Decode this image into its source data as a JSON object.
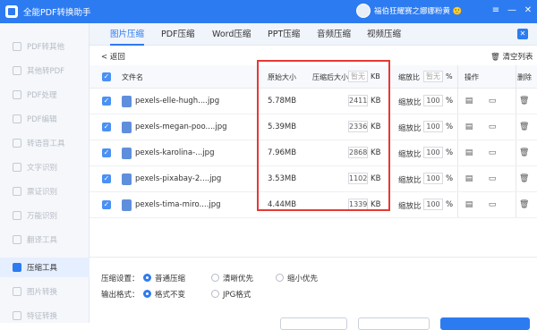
{
  "app": {
    "title": "全能PDF转换助手",
    "user_name": "福伯狂耀赛之娜娜粉黄 🙂"
  },
  "window": {
    "menu": "≡",
    "minimize": "—",
    "close": "✕"
  },
  "sidebar": {
    "items": [
      {
        "label": "PDF转其他"
      },
      {
        "label": "其他转PDF"
      },
      {
        "label": "PDF处理"
      },
      {
        "label": "PDF编辑"
      },
      {
        "label": "转语音工具"
      },
      {
        "label": "文字识别"
      },
      {
        "label": "票证识别"
      },
      {
        "label": "万能识别"
      },
      {
        "label": "翻译工具"
      },
      {
        "label": "压缩工具"
      },
      {
        "label": "图片转换"
      },
      {
        "label": "特征转换"
      }
    ]
  },
  "tabs": [
    {
      "label": "图片压缩"
    },
    {
      "label": "PDF压缩"
    },
    {
      "label": "Word压缩"
    },
    {
      "label": "PPT压缩"
    },
    {
      "label": "音频压缩"
    },
    {
      "label": "视频压缩"
    }
  ],
  "toolbar": {
    "back": "< 返回",
    "clear": "🗑 清空列表",
    "close_panel": "✕"
  },
  "table": {
    "headers": {
      "filename": "文件名",
      "original_size": "原始大小",
      "compressed_size": "压缩后大小",
      "compressed_placeholder": "暂无",
      "kb": "KB",
      "ratio": "缩放比",
      "ratio_placeholder": "暂无",
      "percent": "%",
      "operation": "操作",
      "delete": "删除"
    },
    "rows": [
      {
        "name": "pexels-elle-hugh....jpg",
        "original": "5.78MB",
        "compressed": "2411",
        "kb": "KB",
        "ratio_label": "缩放比",
        "ratio": "100",
        "pct": "%"
      },
      {
        "name": "pexels-megan-poo....jpg",
        "original": "5.39MB",
        "compressed": "2336",
        "kb": "KB",
        "ratio_label": "缩放比",
        "ratio": "100",
        "pct": "%"
      },
      {
        "name": "pexels-karolina-...jpg",
        "original": "7.96MB",
        "compressed": "2868",
        "kb": "KB",
        "ratio_label": "缩放比",
        "ratio": "100",
        "pct": "%"
      },
      {
        "name": "pexels-pixabay-2....jpg",
        "original": "3.53MB",
        "compressed": "1102",
        "kb": "KB",
        "ratio_label": "缩放比",
        "ratio": "100",
        "pct": "%"
      },
      {
        "name": "pexels-tima-miro....jpg",
        "original": "4.44MB",
        "compressed": "1339",
        "kb": "KB",
        "ratio_label": "缩放比",
        "ratio": "100",
        "pct": "%"
      }
    ]
  },
  "settings": {
    "compress_label": "压缩设置：",
    "compress_options": [
      "普通压缩",
      "清晰优先",
      "缩小优先"
    ],
    "output_label": "输出格式：",
    "output_options": [
      "格式不变",
      "JPG格式"
    ]
  },
  "colors": {
    "accent": "#2d7bf0",
    "highlight": "#e53935"
  }
}
